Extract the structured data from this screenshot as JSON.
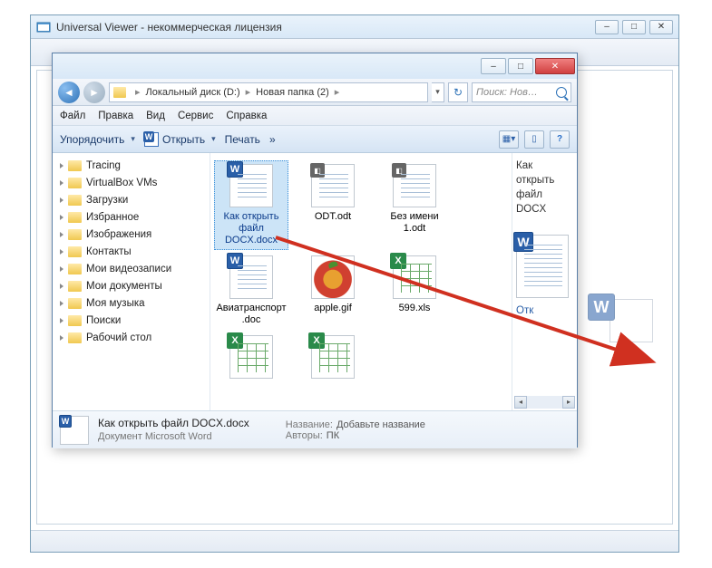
{
  "uv": {
    "title": "Universal Viewer - некоммерческая лицензия"
  },
  "explorer": {
    "breadcrumb": {
      "part1": "Локальный диск (D:)",
      "part2": "Новая папка (2)"
    },
    "search_placeholder": "Поиск: Нов…",
    "menu": {
      "file": "Файл",
      "edit": "Правка",
      "view": "Вид",
      "service": "Сервис",
      "help": "Справка"
    },
    "cmd": {
      "organize": "Упорядочить",
      "open": "Открыть",
      "print": "Печать",
      "more": "»"
    },
    "tree": [
      "Tracing",
      "VirtualBox VMs",
      "Загрузки",
      "Избранное",
      "Изображения",
      "Контакты",
      "Мои видеозаписи",
      "Мои документы",
      "Моя музыка",
      "Поиски",
      "Рабочий стол"
    ],
    "files": [
      {
        "name": "Как открыть файл DOCX.docx",
        "kind": "word",
        "selected": true
      },
      {
        "name": "ODT.odt",
        "kind": "odf",
        "selected": false
      },
      {
        "name": "Без имени 1.odt",
        "kind": "odf",
        "selected": false
      },
      {
        "name": "Авиатранспорт.doc",
        "kind": "word",
        "selected": false
      },
      {
        "name": "apple.gif",
        "kind": "img",
        "selected": false
      },
      {
        "name": "599.xls",
        "kind": "xls",
        "selected": false
      },
      {
        "name": "",
        "kind": "xls",
        "selected": false
      },
      {
        "name": "",
        "kind": "xls",
        "selected": false
      }
    ],
    "preview": {
      "text": "Как открыть файл DOCX",
      "line2": "Отк"
    },
    "details": {
      "filename": "Как открыть файл DOCX.docx",
      "filetype": "Документ Microsoft Word",
      "title_label": "Название:",
      "title_value": "Добавьте название",
      "authors_label": "Авторы:",
      "authors_value": "ПК"
    }
  }
}
